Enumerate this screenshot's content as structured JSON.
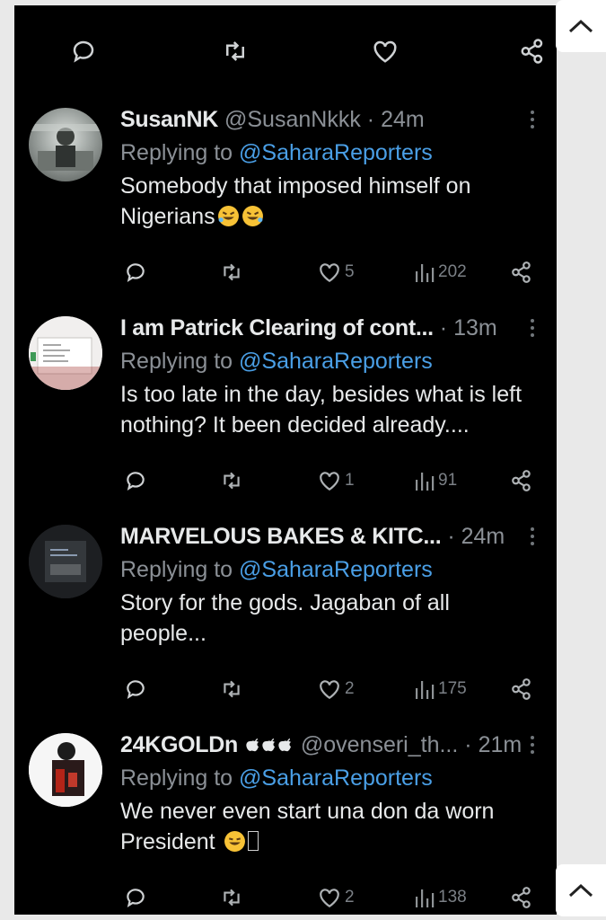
{
  "icons": {
    "reply": "reply-bubble-icon",
    "retweet": "retweet-arrows-icon",
    "like": "heart-icon",
    "views": "bar-chart-icon",
    "share": "share-nodes-icon",
    "more": "vertical-dots-icon",
    "scroll_up": "chevron-up-icon"
  },
  "colors": {
    "background": "#000000",
    "text": "#e7e9ea",
    "muted": "#71767b",
    "link": "#4a9fe6"
  },
  "replies": [
    {
      "name": "SusanNK",
      "handle": "@SusanNkkk",
      "dot": "·",
      "time": "24m",
      "replying_label": "Replying to",
      "replying_to": "@SaharaReporters",
      "text_lines": [
        "Somebody that imposed himself on",
        "Nigerians"
      ],
      "likes": "5",
      "views": "202"
    },
    {
      "name": "I am Patrick Clearing of cont...",
      "handle": "",
      "dot": "·",
      "time": "13m",
      "replying_label": "Replying to",
      "replying_to": "@SaharaReporters",
      "text_lines": [
        "Is too late in the day, besides what is left",
        "nothing?  It been decided already...."
      ],
      "likes": "1",
      "views": "91"
    },
    {
      "name": "MARVELOUS BAKES & KITC...",
      "handle": "",
      "dot": "·",
      "time": "24m",
      "replying_label": "Replying to",
      "replying_to": "@SaharaReporters",
      "text_lines": [
        "Story for the gods. Jagaban of all",
        "people..."
      ],
      "likes": "2",
      "views": "175"
    },
    {
      "name": "24KGOLDn",
      "handle": "@ovenseri_th...",
      "dot": "·",
      "time": "21m",
      "replying_label": "Replying to",
      "replying_to": "@SaharaReporters",
      "text_lines": [
        "We never even start una don da worn",
        "President"
      ],
      "likes": "2",
      "views": "138"
    }
  ]
}
